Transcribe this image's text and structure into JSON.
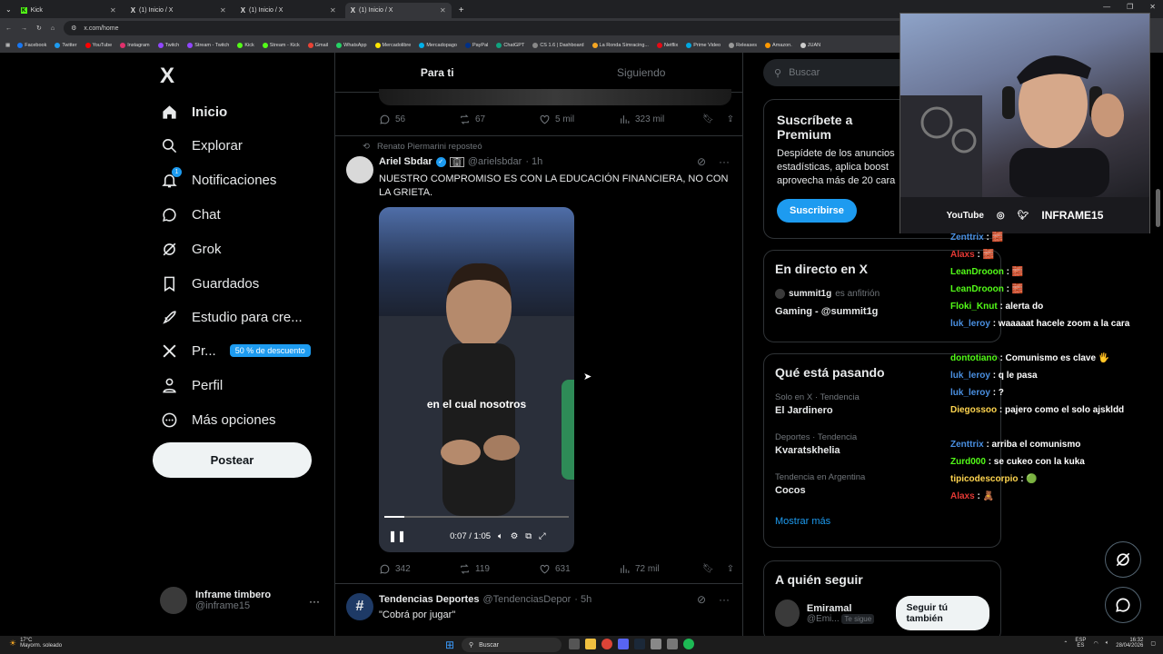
{
  "browser": {
    "tabs": [
      {
        "label": "Kick",
        "fav": "K"
      },
      {
        "label": "(1) Inicio / X",
        "fav": "X"
      },
      {
        "label": "(1) Inicio / X",
        "fav": "X"
      },
      {
        "label": "(1) Inicio / X",
        "fav": "X"
      }
    ],
    "url": "x.com/home",
    "bookmarks": [
      {
        "label": "Facebook",
        "color": "#1877f2"
      },
      {
        "label": "Twitter",
        "color": "#1d9bf0"
      },
      {
        "label": "YouTube",
        "color": "#ff0000"
      },
      {
        "label": "Instagram",
        "color": "#e1306c"
      },
      {
        "label": "Twitch",
        "color": "#9146ff"
      },
      {
        "label": "Stream - Twitch",
        "color": "#9146ff"
      },
      {
        "label": "Kick",
        "color": "#53fc18"
      },
      {
        "label": "Stream - Kick",
        "color": "#53fc18"
      },
      {
        "label": "Gmail",
        "color": "#ea4335"
      },
      {
        "label": "WhatsApp",
        "color": "#25d366"
      },
      {
        "label": "Mercadolibre",
        "color": "#ffe600"
      },
      {
        "label": "Mercadopago",
        "color": "#00b1ea"
      },
      {
        "label": "PayPal",
        "color": "#003087"
      },
      {
        "label": "ChatGPT",
        "color": "#10a37f"
      },
      {
        "label": "CS 1.6 | Dashboard",
        "color": "#888888"
      },
      {
        "label": "La Ronda Simracing...",
        "color": "#f5a623"
      },
      {
        "label": "Netflix",
        "color": "#e50914"
      },
      {
        "label": "Prime Video",
        "color": "#00a8e1"
      },
      {
        "label": "Releases",
        "color": "#999999"
      },
      {
        "label": "Amazon.",
        "color": "#ff9900"
      },
      {
        "label": "JUAN",
        "color": "#cccccc"
      }
    ]
  },
  "nav": {
    "logo": "X",
    "items": [
      {
        "label": "Inicio",
        "icon": "home-icon"
      },
      {
        "label": "Explorar",
        "icon": "search-icon"
      },
      {
        "label": "Notificaciones",
        "icon": "bell-icon",
        "badge": "1"
      },
      {
        "label": "Chat",
        "icon": "chat-icon"
      },
      {
        "label": "Grok",
        "icon": "grok-icon"
      },
      {
        "label": "Guardados",
        "icon": "bookmark-icon"
      },
      {
        "label": "Estudio para cre...",
        "icon": "rocket-icon"
      },
      {
        "label": "Pr...",
        "icon": "x-logo-icon",
        "promo": "50 % de descuento"
      },
      {
        "label": "Perfil",
        "icon": "person-icon"
      },
      {
        "label": "Más opciones",
        "icon": "more-circle-icon"
      }
    ],
    "post_button": "Postear",
    "profile_name": "Inframe timbero",
    "profile_handle": "@inframe15",
    "profile_more": "···"
  },
  "feed": {
    "tabs": [
      "Para ti",
      "Siguiendo"
    ],
    "prev_actions": {
      "replies": "56",
      "reposts": "67",
      "likes": "5 mil",
      "views": "323 mil"
    },
    "tweet": {
      "repost_by": "Renato Piermarini reposteó",
      "name": "Ariel Sbdar",
      "handle": "@arielsbdar",
      "time": "· 1h",
      "text": "NUESTRO COMPROMISO ES CON LA EDUCACIÓN FINANCIERA, NO CON LA GRIETA.",
      "video_caption": "en el cual nosotros",
      "video_time": "0:07 / 1:05",
      "video_progress": 0.107,
      "actions": {
        "replies": "342",
        "reposts": "119",
        "likes": "631",
        "views": "72 mil"
      }
    },
    "next_tweet": {
      "name": "Tendencias Deportes",
      "handle": "@TendenciasDepor",
      "time": "· 5h",
      "text": "\"Cobrá por jugar\""
    }
  },
  "right": {
    "search_placeholder": "Buscar",
    "premium": {
      "title": "Suscríbete a Premium",
      "desc": "Despídete de los anuncios estadísticas, aplica boost aprovecha más de 20 cara",
      "button": "Suscribirse"
    },
    "live": {
      "title": "En directo en X",
      "host": "summit1g",
      "host_note": "es anfitrión",
      "stream": "Gaming - @summit1g"
    },
    "trends": {
      "title": "Qué está pasando",
      "items": [
        {
          "category": "Solo en X · Tendencia",
          "name": "El Jardinero"
        },
        {
          "category": "Deportes · Tendencia",
          "name": "Kvaratskhelia"
        },
        {
          "category": "Tendencia en Argentina",
          "name": "Cocos"
        }
      ],
      "more": "Mostrar más"
    },
    "follow": {
      "title": "A quién seguir",
      "name": "Emiramal",
      "handle": "@Emi...",
      "badge": "Te sigue",
      "button": "Seguir tú también"
    }
  },
  "overlay": {
    "cam_bar": {
      "youtube": "YouTube",
      "channel": "INFRAME15"
    },
    "chat": [
      {
        "user": "Zenttrix",
        "color": "#4a90e2",
        "text": ": 🧱"
      },
      {
        "user": "Alaxs",
        "color": "#e53935",
        "text": ": 🧱"
      },
      {
        "user": "LeanDrooon",
        "color": "#53fc18",
        "text": ": 🧱"
      },
      {
        "user": "LeanDrooon",
        "color": "#53fc18",
        "text": ": 🧱"
      },
      {
        "user": "Floki_Knut",
        "color": "#53fc18",
        "text": ": alerta do"
      },
      {
        "user": "luk_leroy",
        "color": "#4a90e2",
        "text": ": waaaaat hacele zoom a la cara"
      },
      {
        "user": "dontotiano",
        "color": "#53fc18",
        "text": ": Comunismo es clave 🖐"
      },
      {
        "user": "luk_leroy",
        "color": "#4a90e2",
        "text": ": q le pasa"
      },
      {
        "user": "luk_leroy",
        "color": "#4a90e2",
        "text": ": ?"
      },
      {
        "user": "Diegossoo",
        "color": "#ffd54f",
        "text": ": pajero como el solo ajskldd"
      },
      {
        "user": "Zenttrix",
        "color": "#4a90e2",
        "text": ": arriba el comunismo"
      },
      {
        "user": "Zurd000",
        "color": "#53fc18",
        "text": ": se cukeo con la kuka"
      },
      {
        "user": "tipicodescorpio",
        "color": "#ffd54f",
        "text": ": 🟢"
      },
      {
        "user": "Alaxs",
        "color": "#e53935",
        "text": ": 🧸"
      }
    ]
  },
  "taskbar": {
    "weather_temp": "17°C",
    "weather_desc": "Mayorm. soleado",
    "search": "Buscar",
    "lang": "ESP",
    "lang2": "ES",
    "time": "16:32",
    "date": "28/04/2026"
  }
}
